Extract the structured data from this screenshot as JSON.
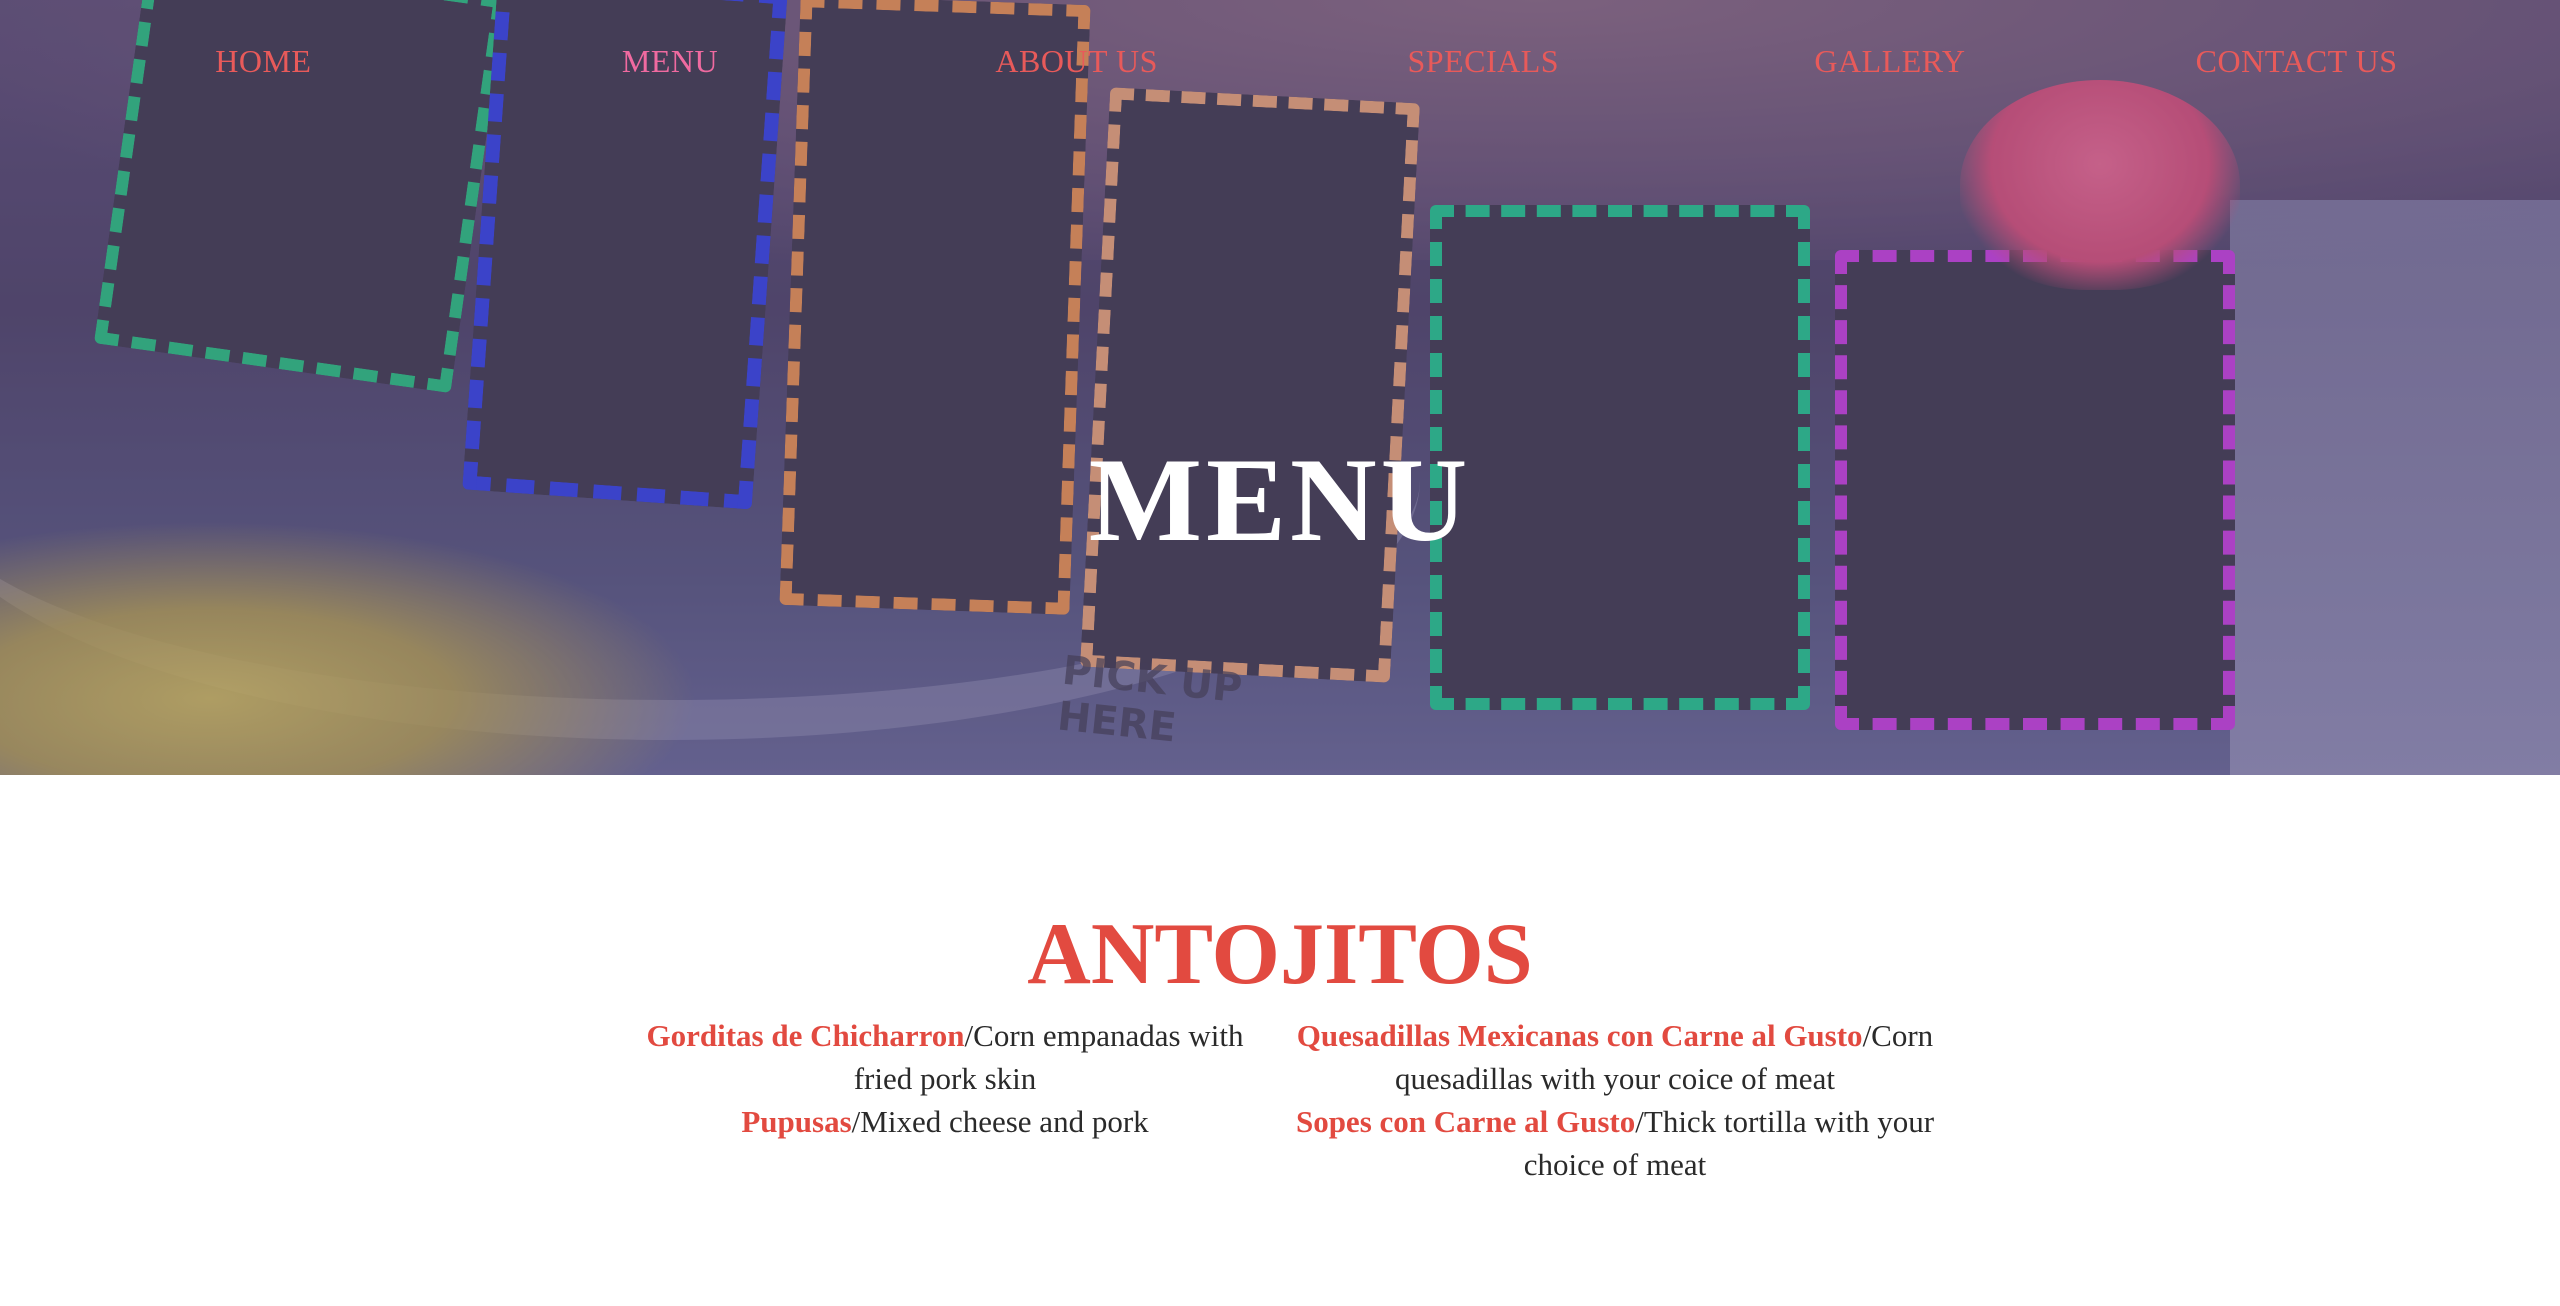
{
  "nav": {
    "items": [
      {
        "label": "HOME"
      },
      {
        "label": "MENU"
      },
      {
        "label": "ABOUT US"
      },
      {
        "label": "SPECIALS"
      },
      {
        "label": "GALLERY"
      },
      {
        "label": "CONTACT US"
      }
    ],
    "active_index": 1,
    "color": "#e85a5a"
  },
  "hero": {
    "title": "MENU",
    "photo_text": "PICK UP HERE"
  },
  "section": {
    "title": "ANTOJITOS",
    "accent_color": "#e24a40",
    "items_left": [
      {
        "name": "Gorditas de Chicharron",
        "description": "/Corn empanadas with fried pork skin"
      },
      {
        "name": "Pupusas",
        "description": "/Mixed cheese and pork"
      }
    ],
    "items_right": [
      {
        "name": "Quesadillas Mexicanas con Carne al Gusto",
        "description": "/Corn quesadillas with your coice of meat"
      },
      {
        "name": "Sopes con Carne al Gusto",
        "description": "/Thick tortilla with your choice of meat"
      }
    ]
  }
}
